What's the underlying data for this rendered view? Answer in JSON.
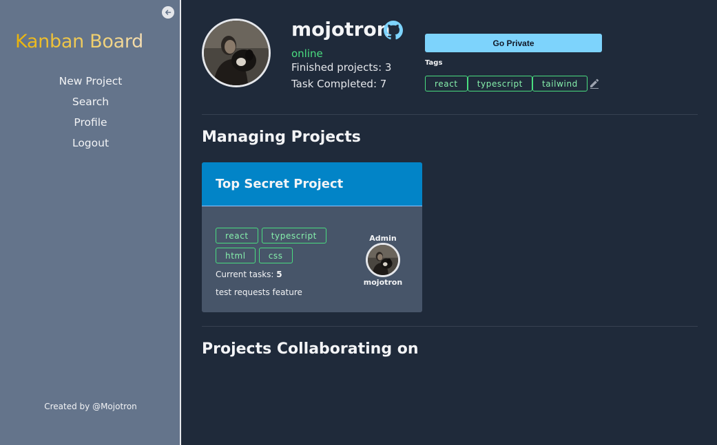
{
  "sidebar": {
    "brand": "Kanban Board",
    "nav": [
      "New Project",
      "Search",
      "Profile",
      "Logout"
    ],
    "credit": "Created by @Mojotron",
    "collapse_icon": "arrow-left-circle-icon"
  },
  "profile": {
    "username": "mojotron",
    "status": "online",
    "finished_projects": "Finished projects: 3",
    "tasks_completed": "Task Completed: 7",
    "go_private_label": "Go Private",
    "tags_label": "Tags",
    "tags": [
      "react",
      "typescript",
      "tailwind"
    ],
    "icons": {
      "github": "github-icon",
      "edit": "pencil-icon"
    }
  },
  "sections": {
    "managing_title": "Managing Projects",
    "collaborating_title": "Projects Collaborating on"
  },
  "project_card": {
    "title": "Top Secret Project",
    "tags": [
      "react",
      "typescript",
      "html",
      "css"
    ],
    "tasks_label": "Current tasks: ",
    "tasks_count": "5",
    "description": "test requests feature",
    "admin_label": "Admin",
    "admin_name": "mojotron"
  },
  "colors": {
    "sidebar_bg": "#64748b",
    "main_bg": "#1f2a3a",
    "accent_blue": "#7dd3fc",
    "card_header": "#0284c7",
    "tag_green": "#4ade80",
    "brand_gold": "#eab308"
  }
}
